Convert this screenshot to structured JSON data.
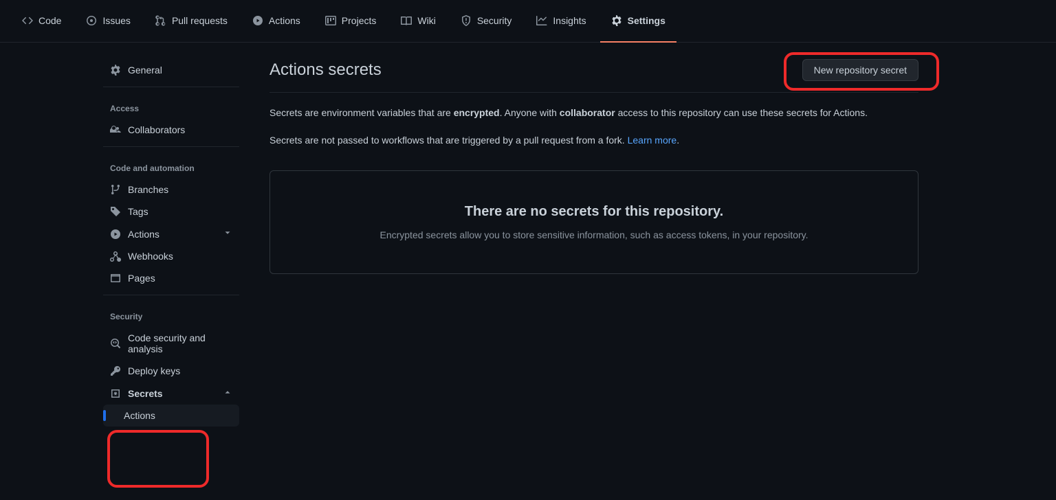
{
  "nav": {
    "code": "Code",
    "issues": "Issues",
    "pulls": "Pull requests",
    "actions": "Actions",
    "projects": "Projects",
    "wiki": "Wiki",
    "security": "Security",
    "insights": "Insights",
    "settings": "Settings"
  },
  "sidebar": {
    "general": "General",
    "access_heading": "Access",
    "collaborators": "Collaborators",
    "code_heading": "Code and automation",
    "branches": "Branches",
    "tags": "Tags",
    "actions": "Actions",
    "webhooks": "Webhooks",
    "pages": "Pages",
    "security_heading": "Security",
    "code_security": "Code security and analysis",
    "deploy_keys": "Deploy keys",
    "secrets": "Secrets",
    "secrets_sub_actions": "Actions"
  },
  "main": {
    "title": "Actions secrets",
    "new_secret_btn": "New repository secret",
    "desc_part1": "Secrets are environment variables that are ",
    "desc_strong1": "encrypted",
    "desc_part2": ". Anyone with ",
    "desc_strong2": "collaborator",
    "desc_part3": " access to this repository can use these secrets for Actions.",
    "desc2_part1": "Secrets are not passed to workflows that are triggered by a pull request from a fork. ",
    "learn_more": "Learn more",
    "desc2_part2": ".",
    "empty_title": "There are no secrets for this repository.",
    "empty_sub": "Encrypted secrets allow you to store sensitive information, such as access tokens, in your repository."
  }
}
